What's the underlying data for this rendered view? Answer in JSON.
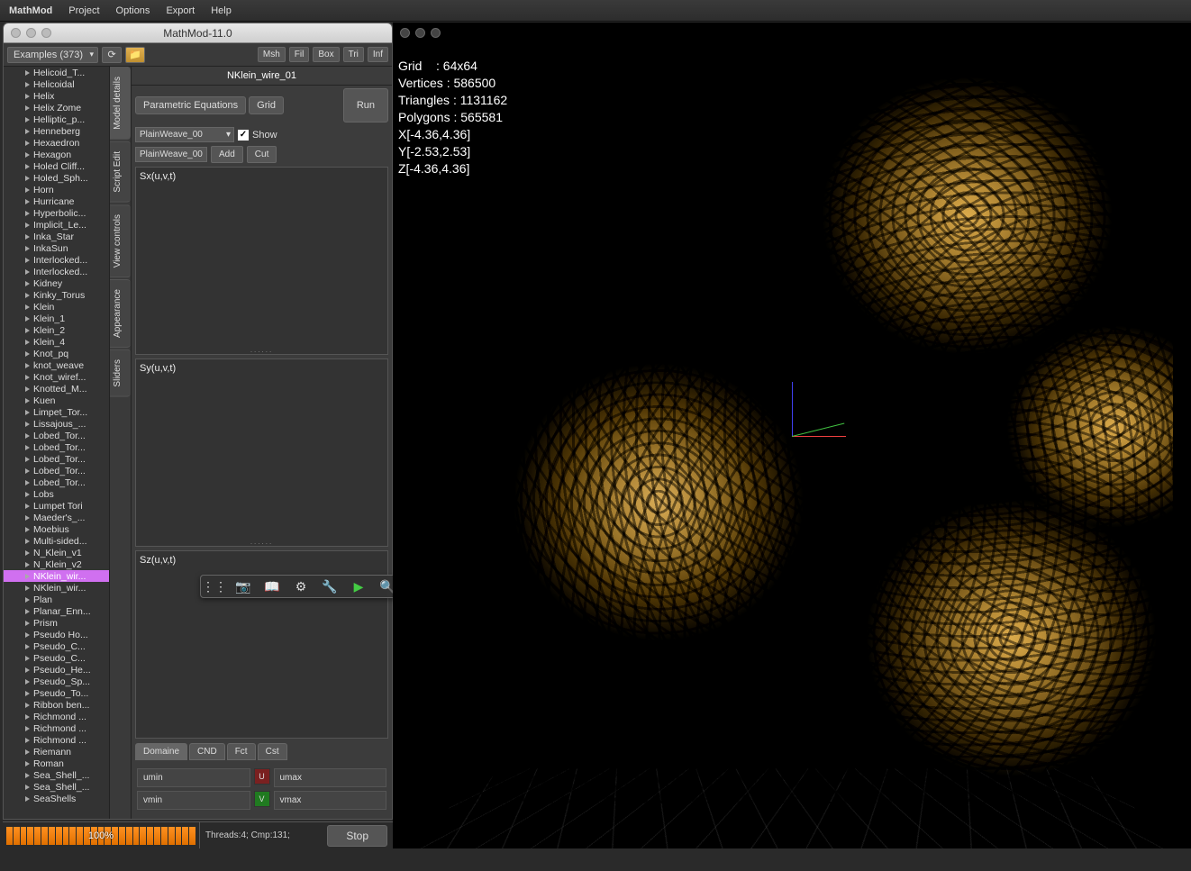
{
  "menubar": {
    "app": "MathMod",
    "items": [
      "Project",
      "Options",
      "Export",
      "Help"
    ]
  },
  "window": {
    "title": "MathMod-11.0"
  },
  "topbar": {
    "examples_label": "Examples (373)",
    "right_buttons": [
      "Msh",
      "Fil",
      "Box",
      "Tri",
      "Inf"
    ]
  },
  "sidebar": {
    "items": [
      "Helicoid_T...",
      "Helicoidal",
      "Helix",
      "Helix Zome",
      "Helliptic_p...",
      "Henneberg",
      "Hexaedron",
      "Hexagon",
      "Holed Cliff...",
      "Holed_Sph...",
      "Horn",
      "Hurricane",
      "Hyperbolic...",
      "Implicit_Le...",
      "Inka_Star",
      "InkaSun",
      "Interlocked...",
      "Interlocked...",
      "Kidney",
      "Kinky_Torus",
      "Klein",
      "Klein_1",
      "Klein_2",
      "Klein_4",
      "Knot_pq",
      "knot_weave",
      "Knot_wiref...",
      "Knotted_M...",
      "Kuen",
      "Limpet_Tor...",
      "Lissajous_...",
      "Lobed_Tor...",
      "Lobed_Tor...",
      "Lobed_Tor...",
      "Lobed_Tor...",
      "Lobed_Tor...",
      "Lobs",
      "Lumpet Tori",
      "Maeder's_...",
      "Moebius",
      "Multi-sided...",
      "N_Klein_v1",
      "N_Klein_v2",
      "NKlein_wir...",
      "NKlein_wir...",
      "Plan",
      "Planar_Enn...",
      "Prism",
      "Pseudo Ho...",
      "Pseudo_C...",
      "Pseudo_C...",
      "Pseudo_He...",
      "Pseudo_Sp...",
      "Pseudo_To...",
      "Ribbon ben...",
      "Richmond ...",
      "Richmond ...",
      "Richmond ...",
      "Riemann",
      "Roman",
      "Sea_Shell_...",
      "Sea_Shell_...",
      "SeaShells"
    ],
    "selected_index": 43
  },
  "vtabs": [
    "Model details",
    "Script Edit",
    "View controls",
    "Appearance",
    "Sliders"
  ],
  "editor": {
    "model_title": "NKlein_wire_01",
    "tab_param": "Parametric Equations",
    "tab_grid": "Grid",
    "run": "Run",
    "select_value": "PlainWeave_00",
    "show_label": "Show",
    "show_checked": "✓",
    "text_value": "PlainWeave_00",
    "add": "Add",
    "cut": "Cut",
    "sx": "Sx(u,v,t)",
    "sy": "Sy(u,v,t)",
    "sz": "Sz(u,v,t)"
  },
  "floattool_icons": [
    "⋮⋮",
    "📷",
    "📖",
    "⚙",
    "🔧",
    "▶",
    "🔍"
  ],
  "bottom_tabs": [
    "Domaine",
    "CND",
    "Fct",
    "Cst"
  ],
  "domain": {
    "umin": "umin",
    "umax": "umax",
    "vmin": "vmin",
    "vmax": "vmax",
    "u": "U",
    "v": "V"
  },
  "status": {
    "progress": "100%",
    "threads": "Threads:4; Cmp:131;",
    "stop": "Stop"
  },
  "overlay": {
    "grid": "Grid    : 64x64",
    "vertices": "Vertices : 586500",
    "triangles": "Triangles : 1131162",
    "polygons": "Polygons : 565581",
    "x": "X[-4.36,4.36]",
    "y": "Y[-2.53,2.53]",
    "z": "Z[-4.36,4.36]"
  }
}
